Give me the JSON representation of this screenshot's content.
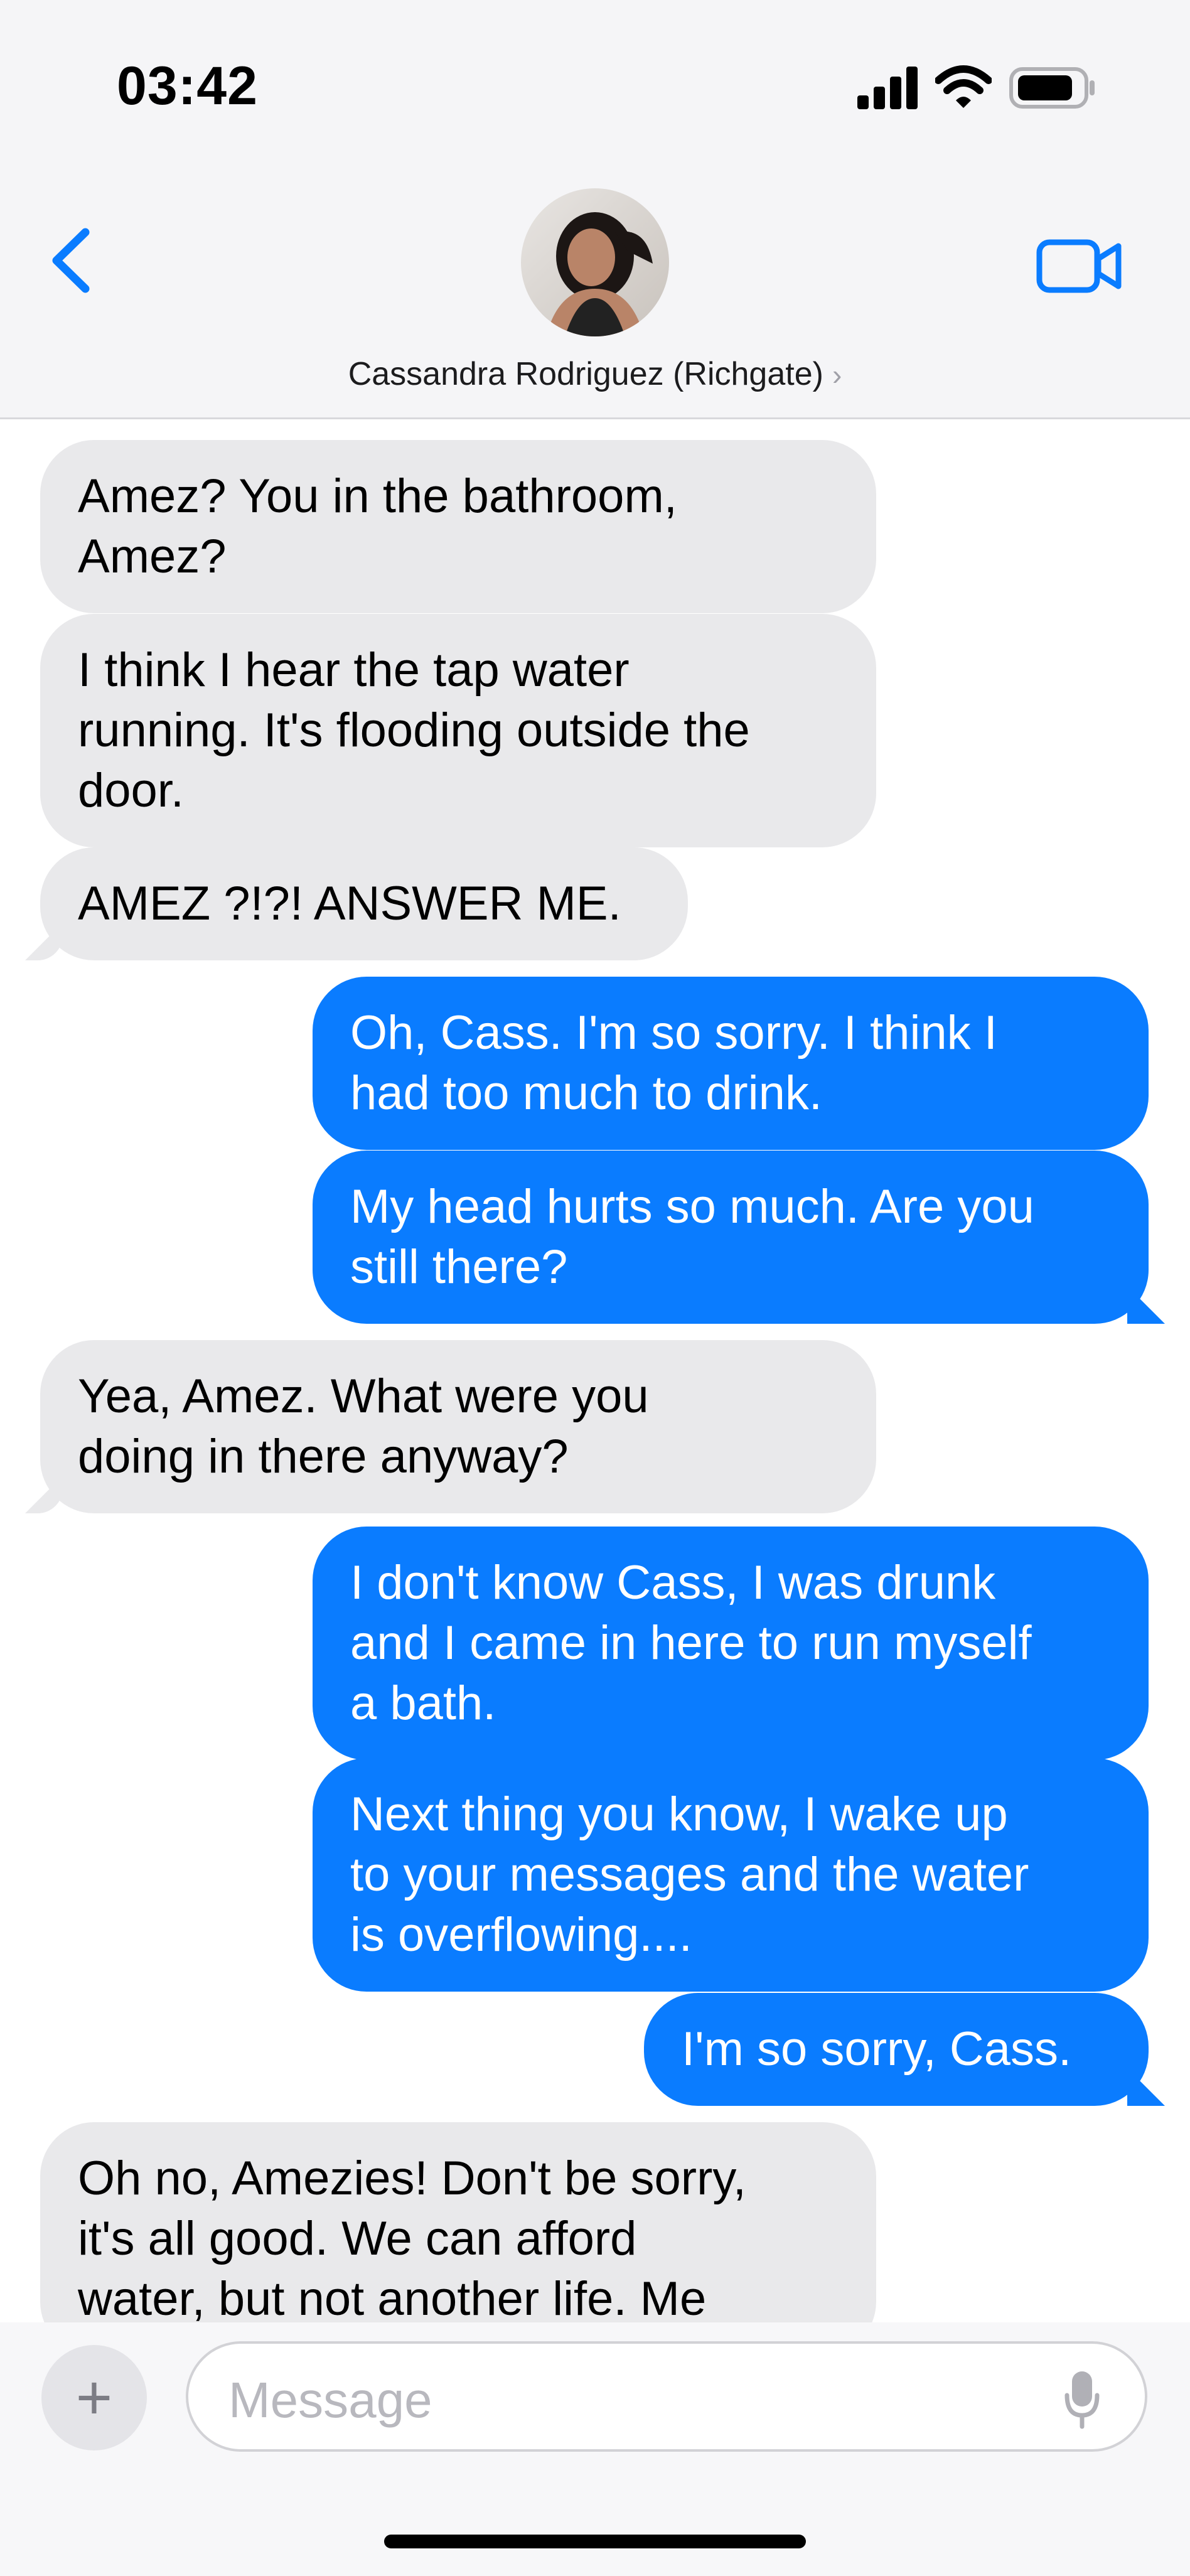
{
  "status": {
    "time": "03:42"
  },
  "header": {
    "contact_name": "Cassandra Rodriguez (Richgate)",
    "chevron": "›"
  },
  "messages": [
    {
      "dir": "in",
      "text": "Amez? You in the bathroom,\nAmez?"
    },
    {
      "dir": "in",
      "text": "I think I hear the tap water\nrunning. It's flooding outside the\ndoor."
    },
    {
      "dir": "in",
      "text": "AMEZ ?!?! ANSWER ME."
    },
    {
      "dir": "out",
      "text": "Oh, Cass. I'm so sorry. I think I\nhad too much to drink."
    },
    {
      "dir": "out",
      "text": "My head hurts so much. Are you\nstill there?"
    },
    {
      "dir": "in",
      "text": "Yea, Amez. What were you\ndoing in there anyway?"
    },
    {
      "dir": "out",
      "text": "I don't know Cass, I was drunk\nand I came in here to run myself\na bath."
    },
    {
      "dir": "out",
      "text": "Next thing you know, I wake up\nto your messages and the water\nis overflowing...."
    },
    {
      "dir": "out",
      "text": "I'm so sorry, Cass."
    },
    {
      "dir": "in",
      "text": "Oh no, Amezies! Don't be sorry,\nit's all good. We can afford\nwater, but not another life. Me"
    }
  ],
  "composer": {
    "placeholder": "Message",
    "plus": "+"
  },
  "colors": {
    "outgoing": "#0a7cff",
    "incoming": "#e9e9eb",
    "accent": "#0a7cff"
  },
  "icons": [
    "back-chevron-icon",
    "video-camera-icon",
    "signal-icon",
    "wifi-icon",
    "battery-icon",
    "microphone-icon",
    "plus-icon"
  ]
}
